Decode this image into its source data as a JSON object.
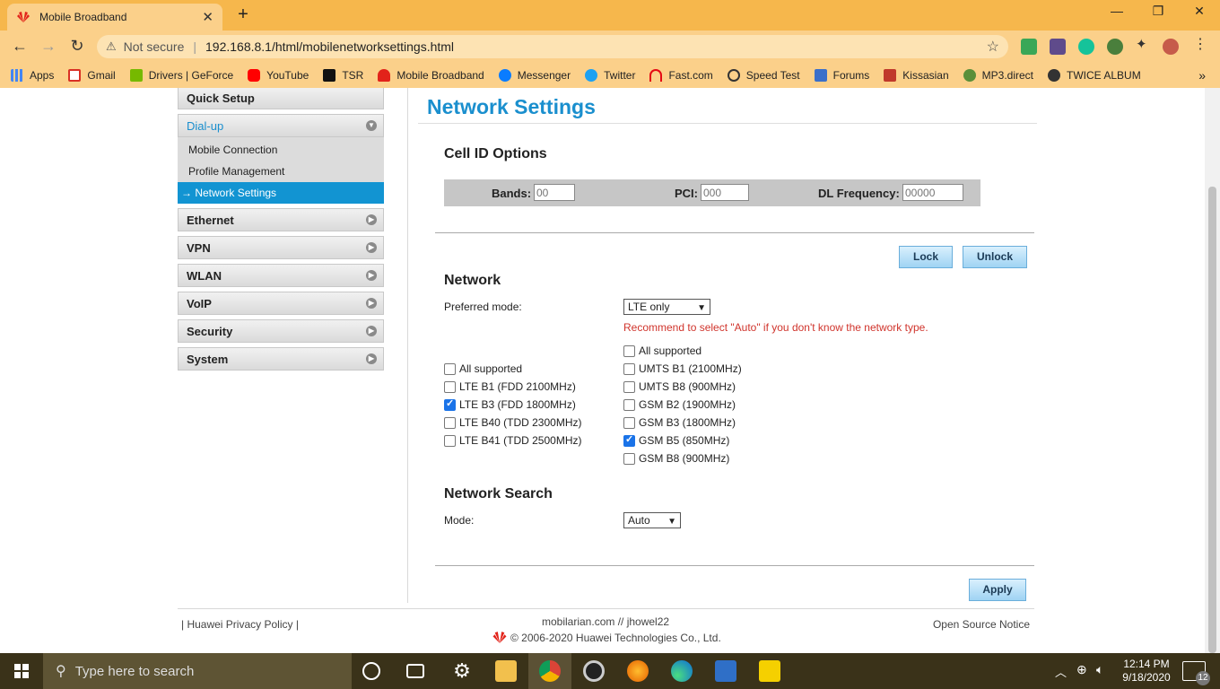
{
  "browser": {
    "tab_title": "Mobile Broadband",
    "security_label": "Not secure",
    "url": "192.168.8.1/html/mobilenetworksettings.html",
    "bookmarks": [
      "Apps",
      "Gmail",
      "Drivers | GeForce",
      "YouTube",
      "TSR",
      "Mobile Broadband",
      "Messenger",
      "Twitter",
      "Fast.com",
      "Speed Test",
      "Forums",
      "Kissasian",
      "MP3.direct",
      "TWICE ALBUM"
    ]
  },
  "sidebar": {
    "quick_setup": "Quick Setup",
    "dialup": "Dial-up",
    "sub_items": [
      "Mobile Connection",
      "Profile Management",
      "Network Settings"
    ],
    "items": [
      "Ethernet",
      "VPN",
      "WLAN",
      "VoIP",
      "Security",
      "System"
    ]
  },
  "main": {
    "title": "Network Settings",
    "cell_id": {
      "heading": "Cell ID Options",
      "bands_label": "Bands:",
      "bands_placeholder": "00",
      "pci_label": "PCI:",
      "pci_placeholder": "000",
      "dl_label": "DL Frequency:",
      "dl_placeholder": "00000",
      "lock": "Lock",
      "unlock": "Unlock"
    },
    "network": {
      "heading": "Network",
      "preferred_label": "Preferred mode:",
      "preferred_value": "LTE only",
      "hint": "Recommend to select \"Auto\" if you don't know the network type.",
      "lte_bands": [
        {
          "label": "All supported",
          "checked": false
        },
        {
          "label": "LTE B1 (FDD 2100MHz)",
          "checked": false
        },
        {
          "label": "LTE B3 (FDD 1800MHz)",
          "checked": true
        },
        {
          "label": "LTE B40 (TDD 2300MHz)",
          "checked": false
        },
        {
          "label": "LTE B41 (TDD 2500MHz)",
          "checked": false
        }
      ],
      "other_bands": [
        {
          "label": "All supported",
          "checked": false
        },
        {
          "label": "UMTS B1 (2100MHz)",
          "checked": false
        },
        {
          "label": "UMTS B8 (900MHz)",
          "checked": false
        },
        {
          "label": "GSM B2 (1900MHz)",
          "checked": false
        },
        {
          "label": "GSM B3 (1800MHz)",
          "checked": false
        },
        {
          "label": "GSM B5 (850MHz)",
          "checked": true
        },
        {
          "label": "GSM B8 (900MHz)",
          "checked": false
        }
      ]
    },
    "search": {
      "heading": "Network Search",
      "mode_label": "Mode:",
      "mode_value": "Auto"
    },
    "apply": "Apply"
  },
  "footer": {
    "privacy": "Huawei Privacy Policy",
    "credit": "mobilarian.com // jhowel22",
    "copyright": "© 2006-2020 Huawei Technologies Co., Ltd.",
    "open_source": "Open Source Notice"
  },
  "taskbar": {
    "search_placeholder": "Type here to search",
    "time": "12:14 PM",
    "date": "9/18/2020",
    "notifications": "12"
  },
  "colors": {
    "accent": "#1a8fce",
    "hint_red": "#d0342c",
    "chrome_orange": "#f6b74c"
  }
}
